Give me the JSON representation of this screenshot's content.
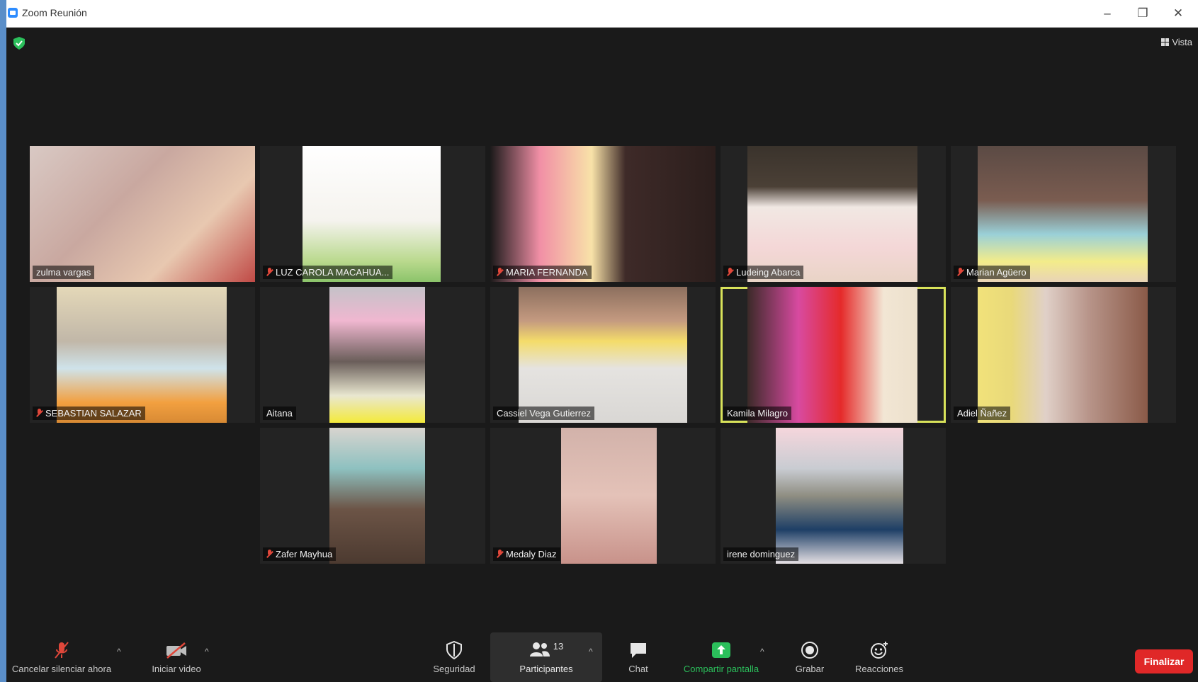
{
  "window": {
    "title": "Zoom Reunión",
    "minimize": "–",
    "restore": "❐",
    "close": "✕"
  },
  "topbar": {
    "view_label": "Vista",
    "shield_color": "#2bbf5b"
  },
  "participants": [
    {
      "name": "zulma vargas",
      "muted": false,
      "active": false
    },
    {
      "name": "LUZ CAROLA MACAHUA...",
      "muted": true,
      "active": false
    },
    {
      "name": "MARIA FERNANDA",
      "muted": true,
      "active": false
    },
    {
      "name": "Ludeing Abarca",
      "muted": true,
      "active": false
    },
    {
      "name": "Marian Agüero",
      "muted": true,
      "active": false
    },
    {
      "name": "SEBASTIAN SALAZAR",
      "muted": true,
      "active": false
    },
    {
      "name": "Aitana",
      "muted": false,
      "active": false
    },
    {
      "name": "Cassiel Vega Gutierrez",
      "muted": false,
      "active": false
    },
    {
      "name": "Kamila Milagro",
      "muted": false,
      "active": true
    },
    {
      "name": "Adiel Ñañez",
      "muted": false,
      "active": false
    },
    {
      "name": "Zafer  Mayhua",
      "muted": true,
      "active": false
    },
    {
      "name": "Medaly Diaz",
      "muted": true,
      "active": false
    },
    {
      "name": "irene dominguez",
      "muted": false,
      "active": false
    }
  ],
  "toolbar": {
    "mute_label": "Cancelar silenciar ahora",
    "video_label": "Iniciar video",
    "security_label": "Seguridad",
    "participants_label": "Participantes",
    "participants_count": "13",
    "chat_label": "Chat",
    "share_label": "Compartir pantalla",
    "record_label": "Grabar",
    "reactions_label": "Reacciones",
    "end_label": "Finalizar",
    "share_color": "#2bbf5b",
    "end_color": "#e02828"
  }
}
